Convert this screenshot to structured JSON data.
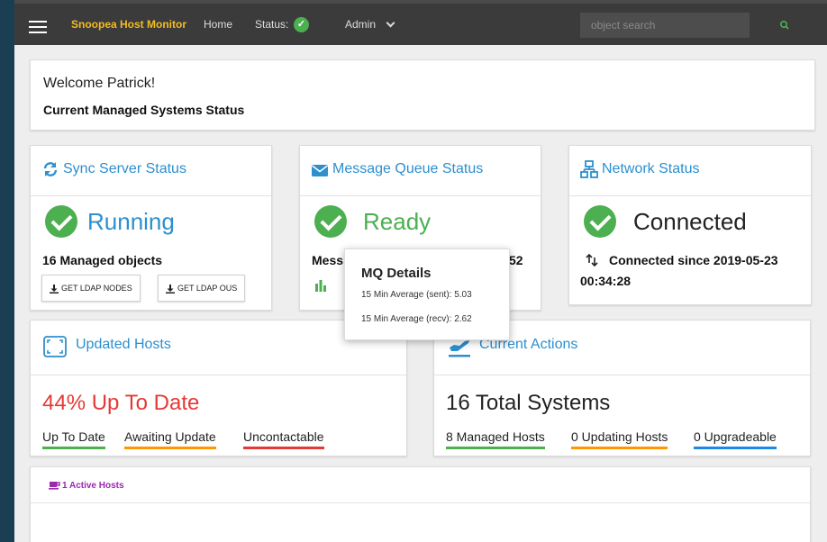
{
  "navbar": {
    "brand": "Snoopea Host Monitor",
    "home": "Home",
    "status_label": "Status:",
    "admin": "Admin",
    "search_placeholder": "object search"
  },
  "welcome": {
    "greeting": "Welcome Patrick!",
    "subtitle": "Current Managed Systems Status"
  },
  "sync_card": {
    "title": "Sync Server Status",
    "status": "Running",
    "managed_objects": "16 Managed objects",
    "btn_nodes": "GET LDAP NODES",
    "btn_ous": "GET LDAP OUS"
  },
  "mq_card": {
    "title": "Message Queue Status",
    "status": "Ready",
    "partial_left": "Mess",
    "partial_right": "52"
  },
  "network_card": {
    "title": "Network Status",
    "status": "Connected",
    "since_line1": "Connected since 2019-05-23",
    "since_line2": "00:34:28"
  },
  "tooltip": {
    "title": "MQ Details",
    "sent": "15 Min Average (sent): 5.03",
    "recv": "15 Min Average (recv): 2.62"
  },
  "updated_card": {
    "title": "Updated Hosts",
    "percent": "44% Up To Date",
    "legend": [
      "Up To Date",
      "Awaiting Update",
      "Uncontactable"
    ]
  },
  "actions_card": {
    "title": "Current Actions",
    "total": "16 Total Systems",
    "legend": [
      "8 Managed Hosts",
      "0 Updating Hosts",
      "0 Upgradeable"
    ]
  },
  "active_card": {
    "title": "1 Active Hosts"
  },
  "colors": {
    "brand": "#f4bd1f",
    "accent_blue": "#2c8fce",
    "success": "#4caf50",
    "danger": "#e53935",
    "warning": "#ff9800",
    "info": "#1e88e5",
    "purple": "#9c27b0"
  }
}
